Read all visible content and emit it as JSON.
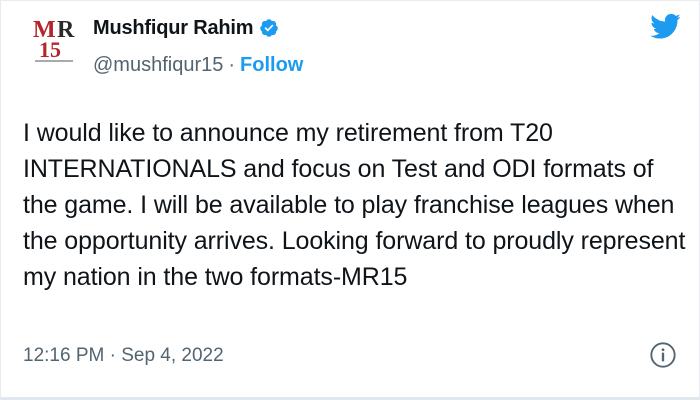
{
  "tweet": {
    "author": {
      "name": "Mushfiqur Rahim",
      "handle": "@mushfiqur15",
      "follow_label": "Follow",
      "separator": "·",
      "verified": true,
      "avatar_text": "MR15"
    },
    "text": "I would like to announce my retirement from T20 INTERNATIONALS and focus on Test and ODI formats of the game. I will be available to play franchise leagues when the opportunity arrives. Looking forward to proudly represent my nation in the two formats-MR15",
    "timestamp": "12:16 PM · Sep 4, 2022"
  },
  "icons": {
    "brand": "twitter-bird-icon",
    "verified": "verified-badge-icon",
    "info": "info-icon"
  },
  "colors": {
    "accent": "#1d9bf0",
    "secondary_text": "#536471",
    "primary_text": "#0f1419"
  }
}
